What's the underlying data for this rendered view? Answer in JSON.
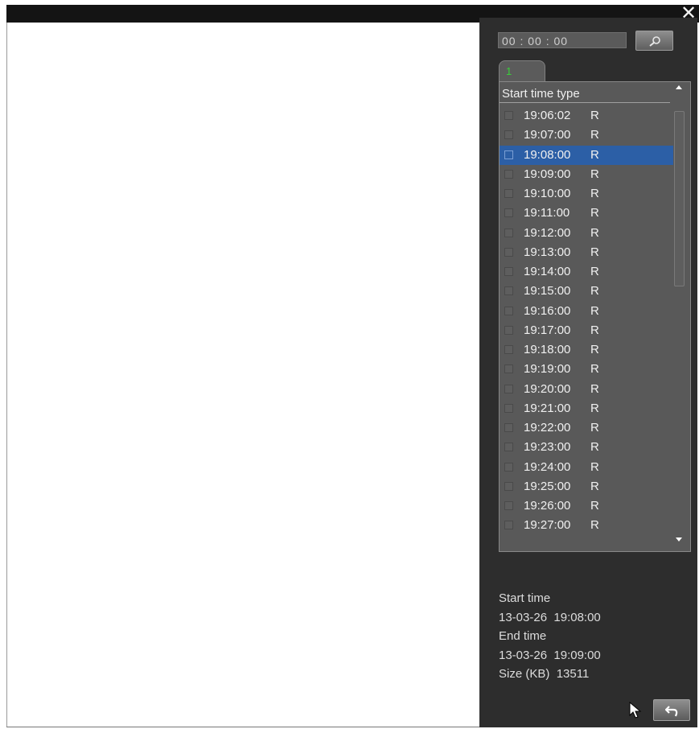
{
  "window": {
    "close_glyph": "✕"
  },
  "search": {
    "time_value": "00 : 00 : 00",
    "button_icon": "search-icon"
  },
  "tabs": [
    {
      "label": "1",
      "color": "#38d038"
    }
  ],
  "file_list": {
    "header": "Start time type",
    "selected_index": 2,
    "selected_color": "#2c5fa6",
    "rows": [
      {
        "time": "19:06:02",
        "type": "R"
      },
      {
        "time": "19:07:00",
        "type": "R"
      },
      {
        "time": "19:08:00",
        "type": "R"
      },
      {
        "time": "19:09:00",
        "type": "R"
      },
      {
        "time": "19:10:00",
        "type": "R"
      },
      {
        "time": "19:11:00",
        "type": "R"
      },
      {
        "time": "19:12:00",
        "type": "R"
      },
      {
        "time": "19:13:00",
        "type": "R"
      },
      {
        "time": "19:14:00",
        "type": "R"
      },
      {
        "time": "19:15:00",
        "type": "R"
      },
      {
        "time": "19:16:00",
        "type": "R"
      },
      {
        "time": "19:17:00",
        "type": "R"
      },
      {
        "time": "19:18:00",
        "type": "R"
      },
      {
        "time": "19:19:00",
        "type": "R"
      },
      {
        "time": "19:20:00",
        "type": "R"
      },
      {
        "time": "19:21:00",
        "type": "R"
      },
      {
        "time": "19:22:00",
        "type": "R"
      },
      {
        "time": "19:23:00",
        "type": "R"
      },
      {
        "time": "19:24:00",
        "type": "R"
      },
      {
        "time": "19:25:00",
        "type": "R"
      },
      {
        "time": "19:26:00",
        "type": "R"
      },
      {
        "time": "19:27:00",
        "type": "R"
      }
    ]
  },
  "info": {
    "start_label": "Start time",
    "start_value": "13-03-26  19:08:00",
    "end_label": "End time",
    "end_value": "13-03-26  19:09:00",
    "size_label": "Size (KB)",
    "size_value": "13511"
  },
  "buttons": {
    "back_icon": "return-icon"
  }
}
